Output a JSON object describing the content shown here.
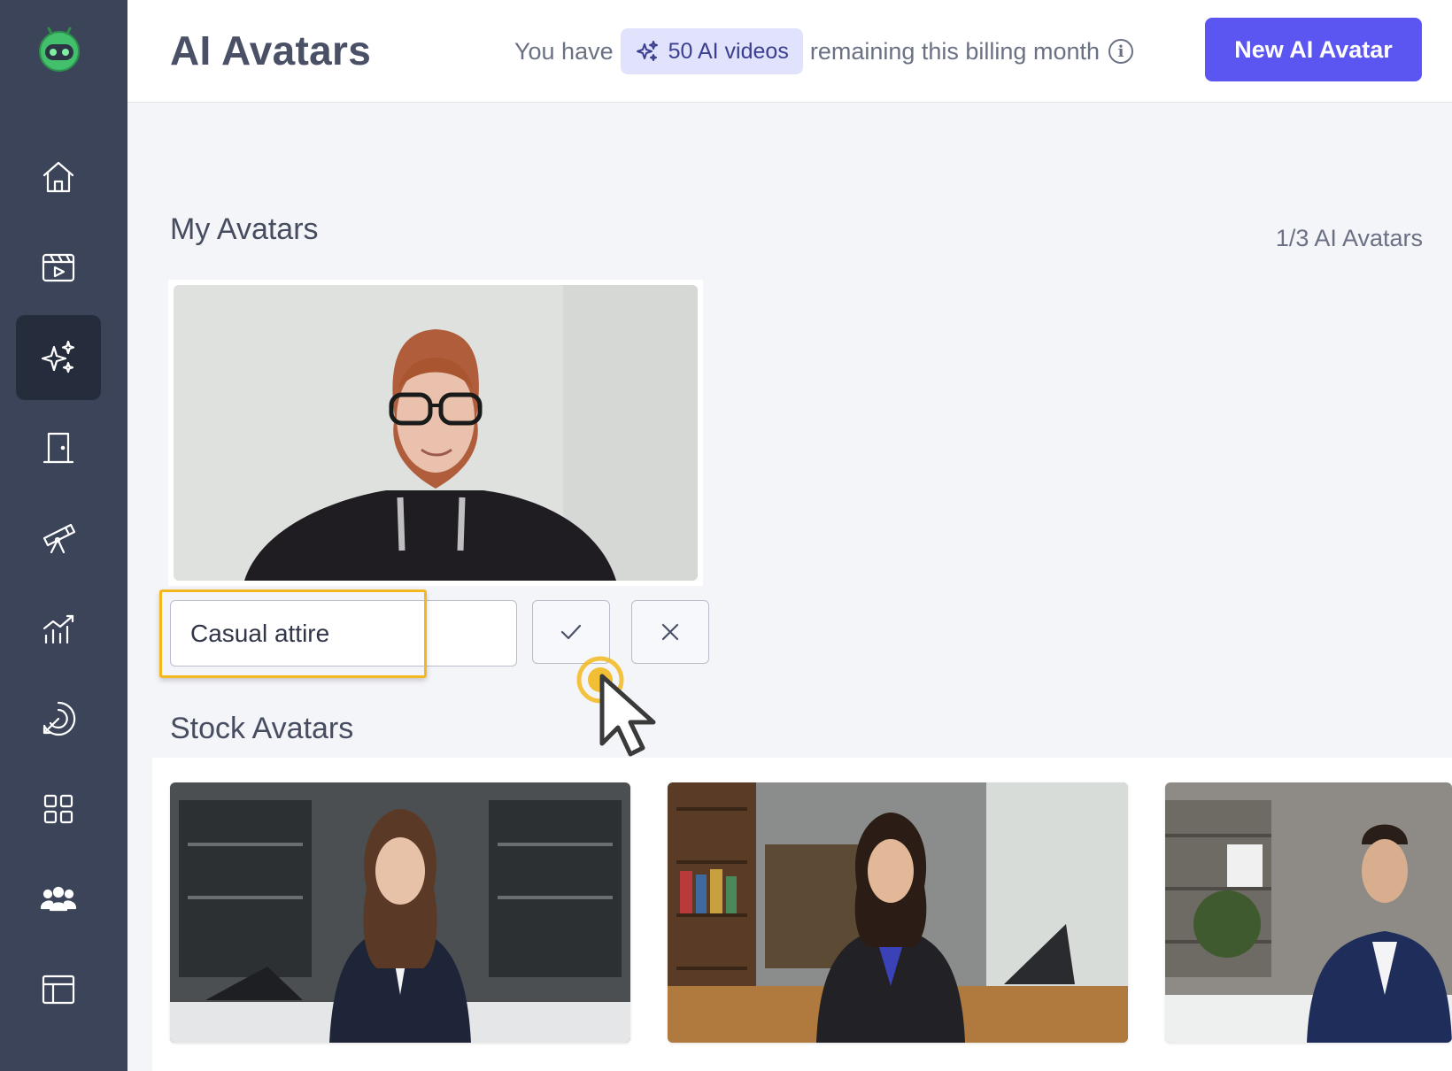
{
  "header": {
    "title": "AI Avatars",
    "quota_prefix": "You have",
    "quota_badge": "50 AI videos",
    "quota_suffix": "remaining this billing month",
    "new_button": "New AI Avatar"
  },
  "sidebar": {
    "items": [
      {
        "icon": "home-icon"
      },
      {
        "icon": "video-library-icon"
      },
      {
        "icon": "sparkles-icon",
        "active": true
      },
      {
        "icon": "door-icon"
      },
      {
        "icon": "telescope-icon"
      },
      {
        "icon": "analytics-icon"
      },
      {
        "icon": "target-icon"
      },
      {
        "icon": "apps-grid-icon"
      },
      {
        "icon": "team-icon"
      },
      {
        "icon": "layout-icon"
      }
    ]
  },
  "my_avatars": {
    "title": "My Avatars",
    "count": "1/3 AI Avatars",
    "edit_name_value": "Casual attire"
  },
  "stock_avatars": {
    "title": "Stock Avatars"
  },
  "colors": {
    "sidebar": "#3b4458",
    "sidebar_active": "#252c3c",
    "accent": "#5b55f2",
    "badge_bg": "#e1e2fb",
    "highlight": "#f2b81d"
  }
}
